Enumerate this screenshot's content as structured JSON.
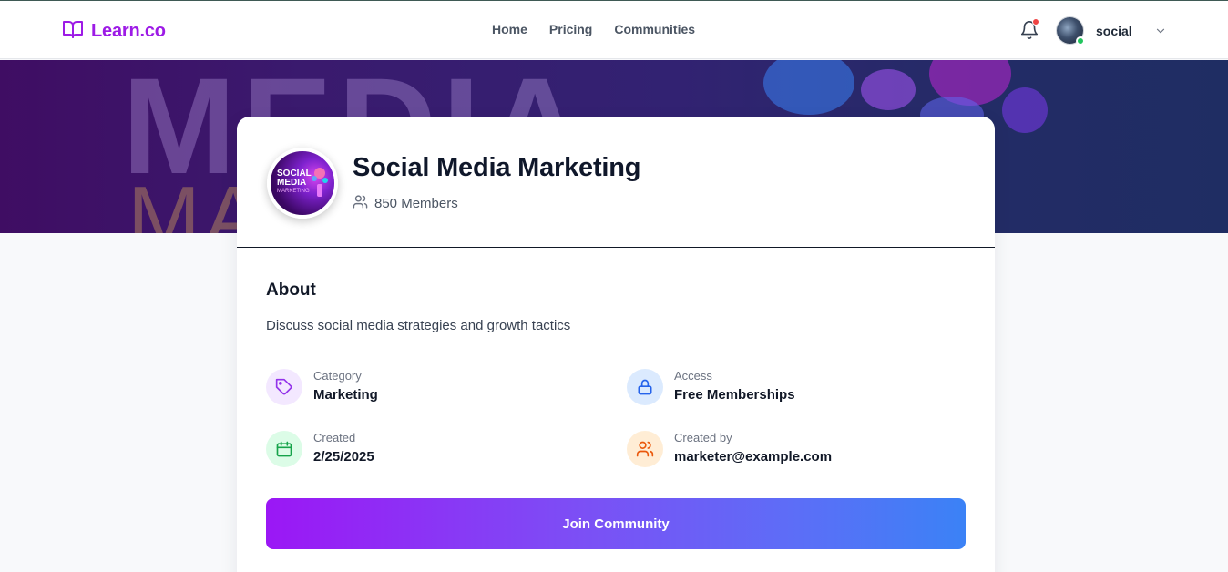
{
  "brand": {
    "name": "Learn.co",
    "icon": "book-open-icon",
    "color": "#9d1be6"
  },
  "nav": {
    "items": [
      "Home",
      "Pricing",
      "Communities"
    ]
  },
  "header": {
    "user_name": "social",
    "bell_icon": "bell-icon",
    "chevron_icon": "chevron-down-icon",
    "status_color": "#22c55e",
    "notify_color": "#ef4444"
  },
  "banner": {
    "text_big": "MEDIA",
    "text_small": "MA"
  },
  "community": {
    "title": "Social Media Marketing",
    "members": "850 Members",
    "logo": {
      "line1": "SOCIAL",
      "line2": "MEDIA",
      "line3": "MARKETING"
    }
  },
  "about": {
    "heading": "About",
    "description": "Discuss social media strategies and growth tactics"
  },
  "details": {
    "category": {
      "label": "Category",
      "value": "Marketing",
      "icon": "tag-icon",
      "color": "#9333ea",
      "bg": "#f3e8ff"
    },
    "access": {
      "label": "Access",
      "value": "Free Memberships",
      "icon": "lock-icon",
      "color": "#2563eb",
      "bg": "#dbeafe"
    },
    "created": {
      "label": "Created",
      "value": "2/25/2025",
      "icon": "calendar-icon",
      "color": "#16a34a",
      "bg": "#dcfce7"
    },
    "created_by": {
      "label": "Created by",
      "value": "marketer@example.com",
      "icon": "users-icon",
      "color": "#ea580c",
      "bg": "#ffedd5"
    }
  },
  "cta": {
    "label": "Join Community",
    "gradient_from": "#9b17f5",
    "gradient_to": "#3b82f6"
  }
}
